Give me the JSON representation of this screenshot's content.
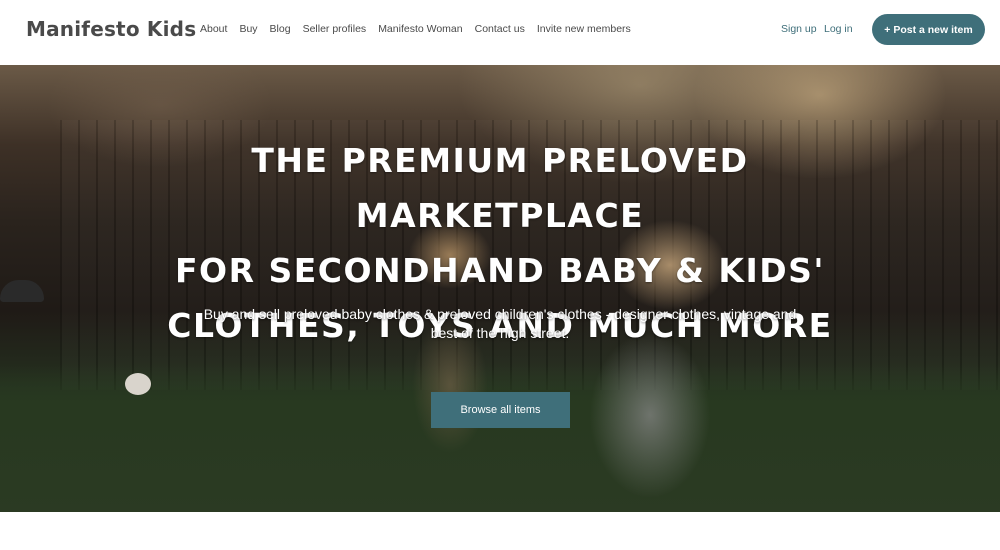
{
  "header": {
    "logo": "Manifesto Kids",
    "nav": [
      {
        "label": "About"
      },
      {
        "label": "Buy"
      },
      {
        "label": "Blog"
      },
      {
        "label": "Seller profiles"
      },
      {
        "label": "Manifesto Woman"
      },
      {
        "label": "Contact us"
      },
      {
        "label": "Invite new members"
      }
    ],
    "signup_label": "Sign up",
    "login_label": "Log in",
    "post_button_label": "+ Post a new item"
  },
  "hero": {
    "headline_lines": [
      "The premium preloved marketplace",
      "for secondhand baby & kids'",
      "clothes, toys and much more"
    ],
    "subtext": "Buy and sell preloved baby clothes & preloved children's clothes - designer clothes, vintage and best of the high street.",
    "browse_button_label": "Browse all items"
  },
  "colors": {
    "accent": "#3f6f7a",
    "text": "#4a4a4a",
    "white": "#ffffff"
  }
}
